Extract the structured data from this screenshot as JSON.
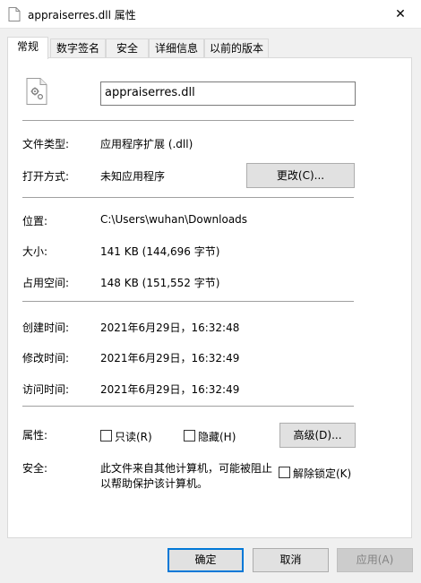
{
  "window": {
    "title": "appraiserres.dll 属性",
    "close_glyph": "✕"
  },
  "tabs": [
    {
      "label": "常规",
      "active": true
    },
    {
      "label": "数字签名"
    },
    {
      "label": "安全"
    },
    {
      "label": "详细信息"
    },
    {
      "label": "以前的版本"
    }
  ],
  "general": {
    "file_name": "appraiserres.dll",
    "type_label": "文件类型:",
    "type_value": "应用程序扩展 (.dll)",
    "open_label": "打开方式:",
    "open_value": "未知应用程序",
    "change_button": "更改(C)...",
    "location_label": "位置:",
    "location_value": "C:\\Users\\wuhan\\Downloads",
    "size_label": "大小:",
    "size_value": "141 KB (144,696 字节)",
    "disk_label": "占用空间:",
    "disk_value": "148 KB (151,552 字节)",
    "created_label": "创建时间:",
    "created_value": "2021年6月29日，16:32:48",
    "modified_label": "修改时间:",
    "modified_value": "2021年6月29日，16:32:49",
    "accessed_label": "访问时间:",
    "accessed_value": "2021年6月29日，16:32:49",
    "attrs_label": "属性:",
    "readonly_label": "只读(R)",
    "hidden_label": "隐藏(H)",
    "advanced_button": "高级(D)...",
    "security_label": "安全:",
    "security_text_line1": "此文件来自其他计算机，可能被阻止",
    "security_text_line2": "以帮助保护该计算机。",
    "unblock_label": "解除锁定(K)"
  },
  "footer": {
    "ok": "确定",
    "cancel": "取消",
    "apply": "应用(A)"
  },
  "colors": {
    "accent": "#0078d7"
  }
}
